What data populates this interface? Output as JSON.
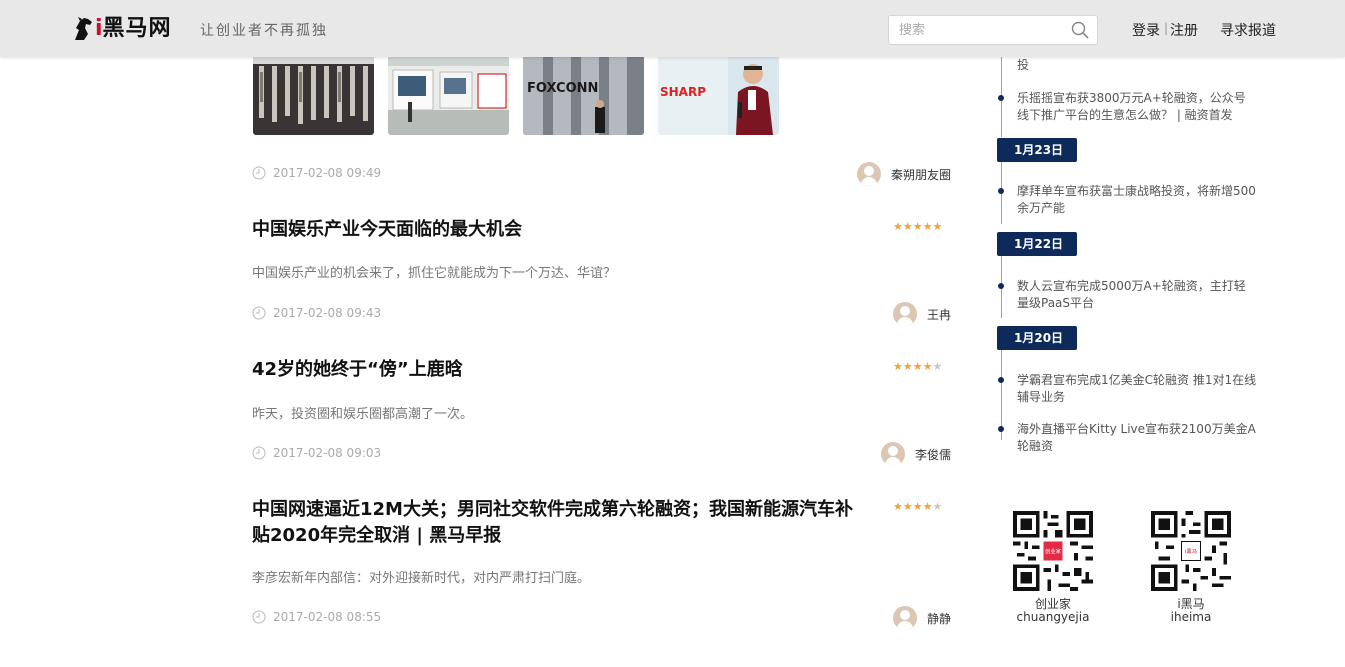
{
  "header": {
    "logo_i": "i",
    "logo_text": "黑马网",
    "slogan": "让创业者不再孤独",
    "search_placeholder": "搜索",
    "login": "登录",
    "separator": "|",
    "register": "注册",
    "seek_report": "寻求报道"
  },
  "articles": [
    {
      "time": "2017-02-08 09:49",
      "author": "秦朔朋友圈"
    },
    {
      "title": "中国娱乐产业今天面临的最大机会",
      "desc": "中国娱乐产业的机会来了，抓住它就能成为下一个万达、华谊？",
      "stars": 5,
      "time": "2017-02-08 09:43",
      "author": "王冉"
    },
    {
      "title": "42岁的她终于“傍”上鹿晗",
      "desc": "昨天，投资圈和娱乐圈都高潮了一次。",
      "stars": 4,
      "time": "2017-02-08 09:03",
      "author": "李俊儒"
    },
    {
      "title": "中国网速逼近12M大关；男同社交软件完成第六轮融资；我国新能源汽车补贴2020年完全取消 | 黑马早报",
      "desc": "李彦宏新年内部信：对外迎接新时代，对内严肃打扫门庭。",
      "stars": 4,
      "time": "2017-02-08 08:55",
      "author": "静静"
    }
  ],
  "thumbnails": [
    "pens",
    "exhibition",
    "foxconn",
    "sharp"
  ],
  "timeline": {
    "item_top_fragment": "投",
    "item_0": "乐摇摇宣布获3800万元A+轮融资，公众号线下推广平台的生意怎么做？ | 融资首发",
    "date_1": "1月23日",
    "item_1": "摩拜单车宣布获富士康战略投资，将新增500余万产能",
    "date_2": "1月22日",
    "item_2": "数人云宣布完成5000万A+轮融资，主打轻量级PaaS平台",
    "date_3": "1月20日",
    "item_3": "学霸君宣布完成1亿美金C轮融资 推1对1在线辅导业务",
    "item_4": "海外直播平台Kitty Live宣布获2100万美金A轮融资"
  },
  "qr": {
    "left_cn": "创业家",
    "left_en": "chuangyejia",
    "right_cn": "i黑马",
    "right_en": "iheima",
    "left_badge": "创业家",
    "right_badge": "i黑马"
  },
  "colors": {
    "accent_navy": "#0d2a5a",
    "star": "#f2a23a",
    "logo_red": "#c8102e"
  }
}
